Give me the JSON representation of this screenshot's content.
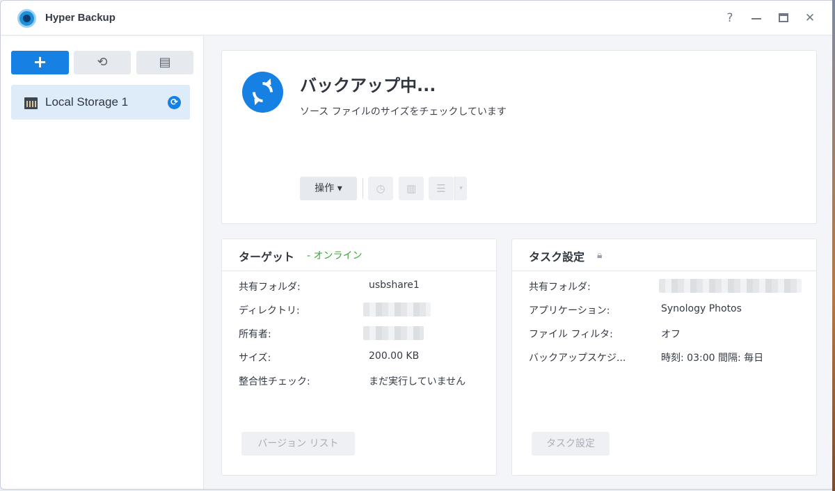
{
  "window": {
    "title": "Hyper Backup",
    "controls": {
      "help": "?"
    }
  },
  "sidebar": {
    "toolbar": [
      {
        "name": "create",
        "icon": "plus-icon",
        "glyph": "+"
      },
      {
        "name": "restore",
        "icon": "history-icon",
        "glyph": "⟲"
      },
      {
        "name": "log",
        "icon": "document-icon",
        "glyph": "▤"
      }
    ],
    "tasks": [
      {
        "name": "Local Storage 1",
        "icon": "storage-icon",
        "status_icon": "sync-icon",
        "status_glyph": "⟳"
      }
    ]
  },
  "status": {
    "icon": "sync-icon",
    "title": "バックアップ中...",
    "subtitle": "ソース ファイルのサイズをチェックしています",
    "action_button": "操作 ▾",
    "tools": [
      {
        "icon": "search-clock-icon",
        "glyph": "◷"
      },
      {
        "icon": "bar-chart-icon",
        "glyph": "▥"
      },
      {
        "icon": "list-icon",
        "glyph": "☰"
      }
    ],
    "dropdown_glyph": "▾"
  },
  "target": {
    "title": "ターゲット",
    "state": "- オンライン",
    "state_color": "#3aa63a",
    "rows": [
      {
        "label": "共有フォルダ:",
        "value": "usbshare1"
      },
      {
        "label": "ディレクトリ:",
        "value": ""
      },
      {
        "label": "所有者:",
        "value": ""
      },
      {
        "label": "サイズ:",
        "value": "200.00 KB"
      },
      {
        "label": "整合性チェック:",
        "value": "まだ実行していません"
      }
    ],
    "button": "バージョン リスト"
  },
  "settings": {
    "title": "タスク設定",
    "lock_icon": "lock-icon",
    "rows": [
      {
        "label": "共有フォルダ:",
        "value": ""
      },
      {
        "label": "アプリケーション:",
        "value": "Synology Photos"
      },
      {
        "label": "ファイル フィルタ:",
        "value": "オフ"
      },
      {
        "label": "バックアップスケジ...",
        "value": "時刻: 03:00 間隔: 毎日"
      }
    ],
    "button": "タスク設定"
  },
  "colors": {
    "accent": "#1680e3",
    "online": "#3aa63a"
  }
}
